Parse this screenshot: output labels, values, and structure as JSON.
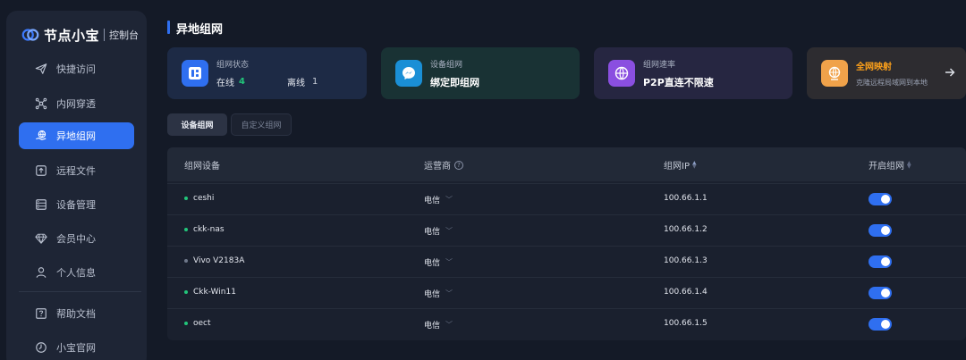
{
  "brand": {
    "name": "节点小宝",
    "subtitle": "控制台"
  },
  "sidebar": {
    "items": [
      {
        "label": "快捷访问",
        "icon": "paper-plane-icon"
      },
      {
        "label": "内网穿透",
        "icon": "network-nodes-icon"
      },
      {
        "label": "异地组网",
        "icon": "globe-hand-icon",
        "active": true
      },
      {
        "label": "远程文件",
        "icon": "upload-file-icon"
      },
      {
        "label": "设备管理",
        "icon": "server-icon"
      },
      {
        "label": "会员中心",
        "icon": "diamond-icon"
      },
      {
        "label": "个人信息",
        "icon": "user-icon"
      }
    ],
    "bottom_items": [
      {
        "label": "帮助文档",
        "icon": "help-doc-icon"
      },
      {
        "label": "小宝官网",
        "icon": "clock-globe-icon"
      }
    ]
  },
  "page": {
    "title": "异地组网"
  },
  "cards": {
    "status": {
      "label": "组网状态",
      "online_label": "在线",
      "online_count": "4",
      "offline_label": "离线",
      "offline_count": "1"
    },
    "device_net": {
      "label": "设备组网",
      "value": "绑定即组网"
    },
    "speed": {
      "label": "组网速率",
      "value": "P2P直连不限速"
    },
    "mapping": {
      "title": "全网映射",
      "subtitle": "克隆远程局域网到本地"
    }
  },
  "tabs": [
    {
      "label": "设备组网",
      "active": true
    },
    {
      "label": "自定义组网",
      "active": false
    }
  ],
  "table": {
    "headers": {
      "device": "组网设备",
      "carrier": "运营商",
      "ip": "组网IP",
      "enable": "开启组网"
    },
    "rows": [
      {
        "name": "ceshi",
        "online": true,
        "carrier": "电信",
        "ip": "100.66.1.1",
        "enabled": true
      },
      {
        "name": "ckk-nas",
        "online": true,
        "carrier": "电信",
        "ip": "100.66.1.2",
        "enabled": true
      },
      {
        "name": "Vivo V2183A",
        "online": false,
        "carrier": "电信",
        "ip": "100.66.1.3",
        "enabled": true
      },
      {
        "name": "Ckk-Win11",
        "online": true,
        "carrier": "电信",
        "ip": "100.66.1.4",
        "enabled": true
      },
      {
        "name": "oect",
        "online": true,
        "carrier": "电信",
        "ip": "100.66.1.5",
        "enabled": true
      }
    ]
  },
  "colors": {
    "accent": "#2f6ff0",
    "online": "#22c57a",
    "orange": "#ffa21a"
  }
}
